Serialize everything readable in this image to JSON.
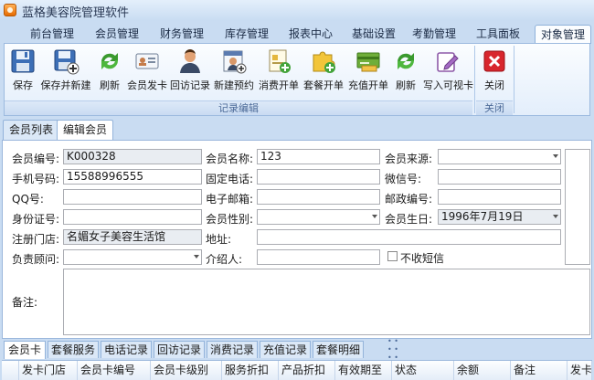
{
  "window": {
    "title": "蓝格美容院管理软件"
  },
  "ribbon_tabs": [
    "前台管理",
    "会员管理",
    "财务管理",
    "库存管理",
    "报表中心",
    "基础设置",
    "考勤管理",
    "工具面板",
    "对象管理"
  ],
  "ribbon": {
    "group_record": "记录编辑",
    "group_close": "关闭",
    "buttons": {
      "save": "保存",
      "save_new": "保存并新建",
      "refresh1": "刷新",
      "issue_card": "会员发卡",
      "visit_record": "回访记录",
      "new_booking": "新建预约",
      "consume_order": "消费开单",
      "package_order": "套餐开单",
      "recharge_order": "充值开单",
      "refresh2": "刷新",
      "write_card": "写入可视卡",
      "close": "关闭"
    }
  },
  "content_tabs": [
    "会员列表",
    "编辑会员"
  ],
  "form": {
    "member_no_label": "会员编号:",
    "member_no": "K000328",
    "member_name_label": "会员名称:",
    "member_name": "123",
    "source_label": "会员来源:",
    "source": "",
    "mobile_label": "手机号码:",
    "mobile": "15588996555",
    "phone_label": "固定电话:",
    "phone": "",
    "wechat_label": "微信号:",
    "wechat": "",
    "qq_label": "QQ号:",
    "qq": "",
    "email_label": "电子邮箱:",
    "email": "",
    "zip_label": "邮政编号:",
    "zip": "",
    "idcard_label": "身份证号:",
    "idcard": "",
    "gender_label": "会员性别:",
    "gender": "",
    "birthday_label": "会员生日:",
    "birthday": "1996年7月19日",
    "store_label": "注册门店:",
    "store": "名媚女子美容生活馆",
    "address_label": "地址:",
    "address": "",
    "consultant_label": "负责顾问:",
    "consultant": "",
    "referrer_label": "介绍人:",
    "referrer": "",
    "no_sms_label": "不收短信",
    "remark_label": "备注:"
  },
  "bottom_tabs": [
    "会员卡",
    "套餐服务",
    "电话记录",
    "回访记录",
    "消费记录",
    "充值记录",
    "套餐明细"
  ],
  "grid_columns": [
    "发卡门店",
    "会员卡编号",
    "会员卡级别",
    "服务折扣",
    "产品折扣",
    "有效期至",
    "状态",
    "余额",
    "备注",
    "发卡"
  ],
  "icons": {
    "save": "floppy-disk-icon",
    "save_new": "floppy-plus-icon",
    "refresh": "green-refresh-icon",
    "issue_card": "id-card-icon",
    "visit": "person-icon",
    "booking": "calendar-person-icon",
    "consume": "document-plus-icon",
    "package": "puzzle-plus-icon",
    "recharge": "money-card-icon",
    "write_card": "pencil-edit-icon",
    "close": "red-x-icon"
  },
  "colors": {
    "accent": "#c9dcf2",
    "close_red": "#d8262d",
    "green": "#3a9a2e"
  }
}
